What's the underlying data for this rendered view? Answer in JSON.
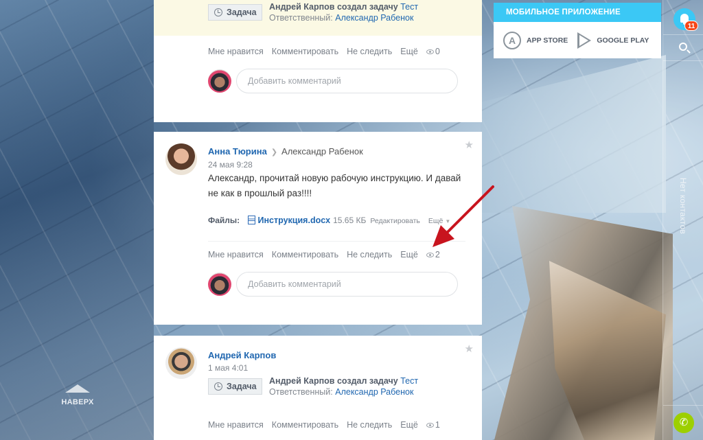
{
  "feed": {
    "top_post": {
      "task": {
        "badge": "Задача",
        "created_by": "Андрей Карпов создал задачу",
        "task_title": "Тест",
        "responsible_label": "Ответственный:",
        "responsible_name": "Александр Рабенок"
      },
      "actions": {
        "like": "Мне нравится",
        "comment": "Комментировать",
        "unfollow": "Не следить",
        "more": "Ещё",
        "views": "0"
      },
      "comment_placeholder": "Добавить комментарий"
    },
    "middle_post": {
      "author": "Анна Тюрина",
      "target": "Александр Рабенок",
      "date": "24 мая 9:28",
      "text": "Александр, прочитай новую рабочую инструкцию. И давай не как в прошлый раз!!!!",
      "files": {
        "label": "Файлы:",
        "file_name": "Инструкция.docx",
        "file_size": "15.65 КБ",
        "edit": "Редактировать",
        "more": "Ещё"
      },
      "actions": {
        "like": "Мне нравится",
        "comment": "Комментировать",
        "unfollow": "Не следить",
        "more": "Ещё",
        "views": "2"
      },
      "comment_placeholder": "Добавить комментарий"
    },
    "bottom_post": {
      "author": "Андрей Карпов",
      "date": "1 мая 4:01",
      "task": {
        "badge": "Задача",
        "created_by": "Андрей Карпов создал задачу",
        "task_title": "Тест",
        "responsible_label": "Ответственный:",
        "responsible_name": "Александр Рабенок"
      },
      "actions": {
        "like": "Мне нравится",
        "comment": "Комментировать",
        "unfollow": "Не следить",
        "more": "Ещё",
        "views": "1"
      }
    }
  },
  "promo": {
    "title": "МОБИЛЬНОЕ ПРИЛОЖЕНИЕ",
    "app_store": "APP STORE",
    "google_play": "GOOGLE PLAY"
  },
  "sidebar": {
    "notifications_count": "11",
    "contacts_text": "Нет контактов"
  },
  "left": {
    "up_label": "НАВЕРХ"
  },
  "colors": {
    "accent": "#3bc8f5",
    "link": "#2067b0",
    "badge": "#f54819",
    "call": "#9dcf00",
    "annotation": "#c8141e"
  },
  "icons": [
    "clock-icon",
    "star-icon",
    "eye-icon",
    "file-icon",
    "app-store-icon",
    "google-play-icon",
    "bell-icon",
    "search-icon",
    "phone-icon",
    "arrow-up-icon"
  ]
}
